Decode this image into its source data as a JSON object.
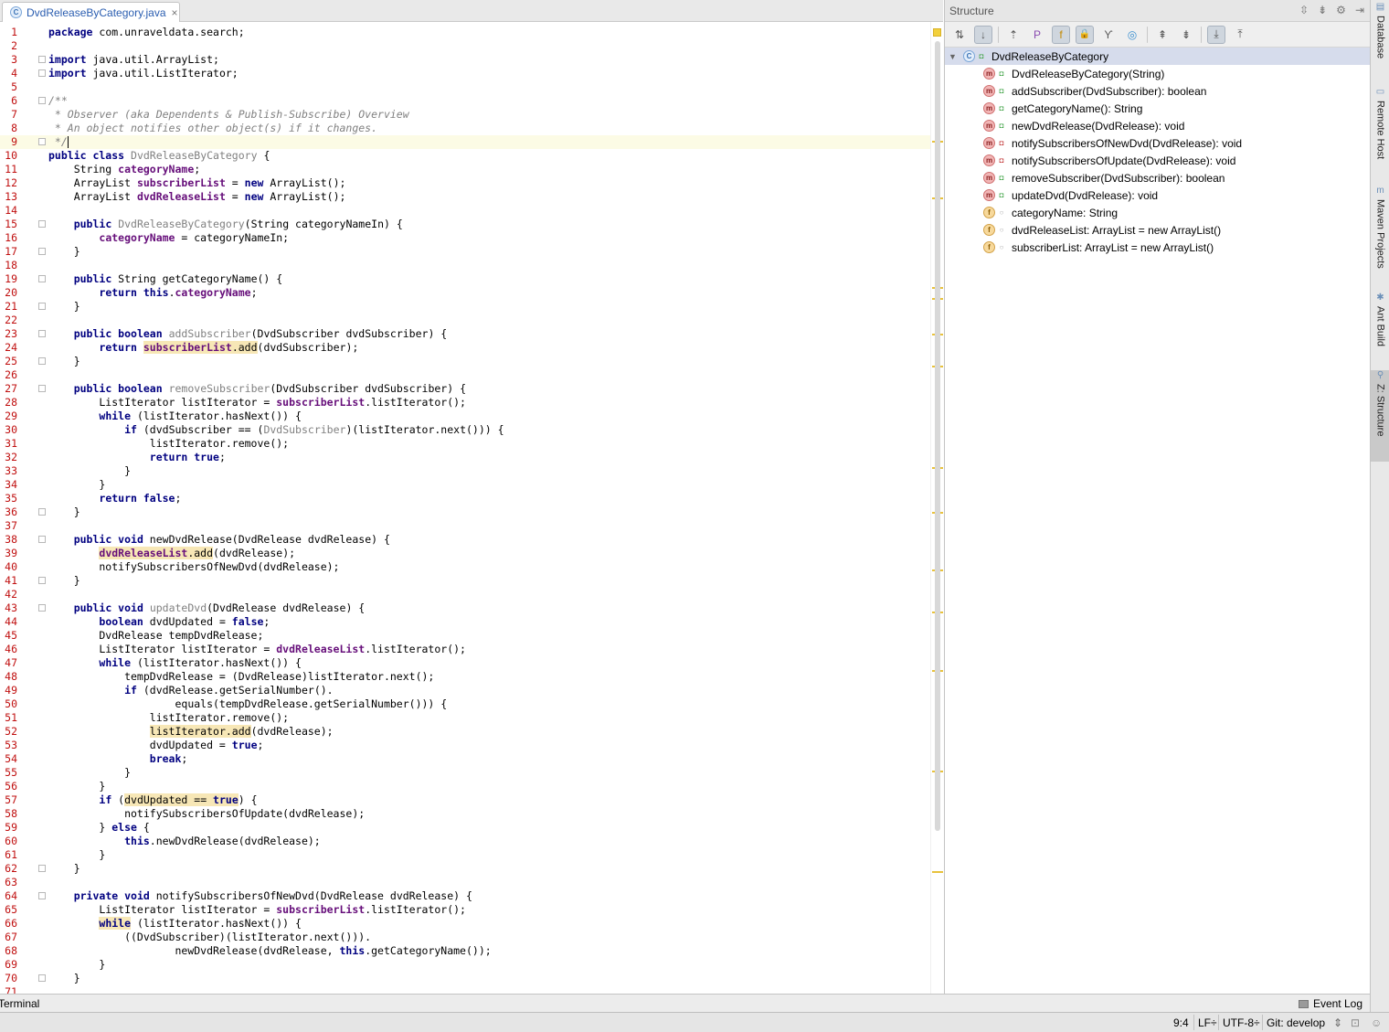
{
  "tab": {
    "icon": "C",
    "label": "DvdReleaseByCategory.java",
    "close": "×"
  },
  "editor": {
    "lines": [
      {
        "n": "1",
        "html": "<span class=\"k\">package</span> com.unraveldata.search;"
      },
      {
        "n": "2",
        "html": ""
      },
      {
        "n": "3",
        "html": "<span class=\"k\">import</span> java.util.ArrayList;"
      },
      {
        "n": "4",
        "html": "<span class=\"k\">import</span> java.util.ListIterator;"
      },
      {
        "n": "5",
        "html": ""
      },
      {
        "n": "6",
        "html": "<span class=\"c\">/**</span>"
      },
      {
        "n": "7",
        "html": "<span class=\"c\"> * Observer (aka Dependents &amp; Publish-Subscribe) Overview</span>"
      },
      {
        "n": "8",
        "html": "<span class=\"c\"> * An object notifies other object(s) if it changes.</span>"
      },
      {
        "n": "9",
        "html": "<span class=\"c\"> */</span><span class=\"caret\"></span>"
      },
      {
        "n": "10",
        "html": "<span class=\"k\">public class</span> <span class=\"u\">DvdReleaseByCategory</span> {"
      },
      {
        "n": "11",
        "html": "    String <span class=\"f\">categoryName</span>;"
      },
      {
        "n": "12",
        "html": "    ArrayList <span class=\"f\">subscriberList</span> = <span class=\"k\">new</span> ArrayList();"
      },
      {
        "n": "13",
        "html": "    ArrayList <span class=\"f\">dvdReleaseList</span> = <span class=\"k\">new</span> ArrayList();"
      },
      {
        "n": "14",
        "html": ""
      },
      {
        "n": "15",
        "html": "    <span class=\"k\">public</span> <span class=\"u\">DvdReleaseByCategory</span>(String categoryNameIn) {"
      },
      {
        "n": "16",
        "html": "        <span class=\"f\">categoryName</span> = categoryNameIn;"
      },
      {
        "n": "17",
        "html": "    }"
      },
      {
        "n": "18",
        "html": ""
      },
      {
        "n": "19",
        "html": "    <span class=\"k\">public</span> String getCategoryName() {"
      },
      {
        "n": "20",
        "html": "        <span class=\"k\">return this</span>.<span class=\"f\">categoryName</span>;"
      },
      {
        "n": "21",
        "html": "    }"
      },
      {
        "n": "22",
        "html": ""
      },
      {
        "n": "23",
        "html": "    <span class=\"k\">public boolean</span> <span class=\"u\">addSubscriber</span>(DvdSubscriber dvdSubscriber) {"
      },
      {
        "n": "24",
        "html": "        <span class=\"k\">return</span> <span class=\"hl\"><span class=\"f\">subscriberList</span>.add</span>(dvdSubscriber);"
      },
      {
        "n": "25",
        "html": "    }"
      },
      {
        "n": "26",
        "html": ""
      },
      {
        "n": "27",
        "html": "    <span class=\"k\">public boolean</span> <span class=\"u\">removeSubscriber</span>(DvdSubscriber dvdSubscriber) {"
      },
      {
        "n": "28",
        "html": "        ListIterator listIterator = <span class=\"f\">subscriberList</span>.listIterator();"
      },
      {
        "n": "29",
        "html": "        <span class=\"k\">while</span> (listIterator.hasNext()) {"
      },
      {
        "n": "30",
        "html": "            <span class=\"k\">if</span> (dvdSubscriber == (<span class=\"u\">DvdSubscriber</span>)(listIterator.next())) {"
      },
      {
        "n": "31",
        "html": "                listIterator.remove();"
      },
      {
        "n": "32",
        "html": "                <span class=\"k\">return true</span>;"
      },
      {
        "n": "33",
        "html": "            }"
      },
      {
        "n": "34",
        "html": "        }"
      },
      {
        "n": "35",
        "html": "        <span class=\"k\">return false</span>;"
      },
      {
        "n": "36",
        "html": "    }"
      },
      {
        "n": "37",
        "html": ""
      },
      {
        "n": "38",
        "html": "    <span class=\"k\">public void</span> newDvdRelease(DvdRelease dvdRelease) {"
      },
      {
        "n": "39",
        "html": "        <span class=\"hl\"><span class=\"f\">dvdReleaseList</span>.add</span>(dvdRelease);"
      },
      {
        "n": "40",
        "html": "        notifySubscribersOfNewDvd(dvdRelease);"
      },
      {
        "n": "41",
        "html": "    }"
      },
      {
        "n": "42",
        "html": ""
      },
      {
        "n": "43",
        "html": "    <span class=\"k\">public void</span> <span class=\"u\">updateDvd</span>(DvdRelease dvdRelease) {"
      },
      {
        "n": "44",
        "html": "        <span class=\"k\">boolean</span> dvdUpdated = <span class=\"k\">false</span>;"
      },
      {
        "n": "45",
        "html": "        DvdRelease tempDvdRelease;"
      },
      {
        "n": "46",
        "html": "        ListIterator listIterator = <span class=\"f\">dvdReleaseList</span>.listIterator();"
      },
      {
        "n": "47",
        "html": "        <span class=\"k\">while</span> (listIterator.hasNext()) {"
      },
      {
        "n": "48",
        "html": "            tempDvdRelease = (DvdRelease)listIterator.next();"
      },
      {
        "n": "49",
        "html": "            <span class=\"k\">if</span> (dvdRelease.getSerialNumber()."
      },
      {
        "n": "50",
        "html": "                    equals(tempDvdRelease.getSerialNumber())) {"
      },
      {
        "n": "51",
        "html": "                listIterator.remove();"
      },
      {
        "n": "52",
        "html": "                <span class=\"hl\">listIterator.add</span>(dvdRelease);"
      },
      {
        "n": "53",
        "html": "                dvdUpdated = <span class=\"k\">true</span>;"
      },
      {
        "n": "54",
        "html": "                <span class=\"k\">break</span>;"
      },
      {
        "n": "55",
        "html": "            }"
      },
      {
        "n": "56",
        "html": "        }"
      },
      {
        "n": "57",
        "html": "        <span class=\"k\">if</span> (<span class=\"hl\">dvdUpdated == <span class=\"k\">true</span></span>) {"
      },
      {
        "n": "58",
        "html": "            notifySubscribersOfUpdate(dvdRelease);"
      },
      {
        "n": "59",
        "html": "        } <span class=\"k\">else</span> {"
      },
      {
        "n": "60",
        "html": "            <span class=\"k\">this</span>.newDvdRelease(dvdRelease);"
      },
      {
        "n": "61",
        "html": "        }"
      },
      {
        "n": "62",
        "html": "    }"
      },
      {
        "n": "63",
        "html": ""
      },
      {
        "n": "64",
        "html": "    <span class=\"k\">private void</span> notifySubscribersOfNewDvd(DvdRelease dvdRelease) {"
      },
      {
        "n": "65",
        "html": "        ListIterator listIterator = <span class=\"f\">subscriberList</span>.listIterator();"
      },
      {
        "n": "66",
        "html": "        <span class=\"k hl\">while</span> (listIterator.hasNext()) {"
      },
      {
        "n": "67",
        "html": "            ((DvdSubscriber)(listIterator.next()))."
      },
      {
        "n": "68",
        "html": "                    newDvdRelease(dvdRelease, <span class=\"k\">this</span>.getCategoryName());"
      },
      {
        "n": "69",
        "html": "        }"
      },
      {
        "n": "70",
        "html": "    }"
      },
      {
        "n": "71",
        "html": ""
      }
    ],
    "fold_lines": [
      3,
      4,
      6,
      9,
      15,
      17,
      19,
      21,
      23,
      25,
      27,
      36,
      38,
      41,
      43,
      62,
      64,
      70
    ]
  },
  "stripe_marks": [
    154,
    216,
    314,
    326,
    365,
    400,
    511,
    560,
    623,
    669,
    733,
    843,
    953
  ],
  "structure": {
    "title": "Structure",
    "toolbar_icons": [
      "sort-by-type-icon",
      "sort-alpha-icon",
      "inherited-icon",
      "properties-icon",
      "fields-icon",
      "non-public-icon",
      "lambda-icon",
      "anonymous-icon",
      "expand-all-icon",
      "collapse-all-icon",
      "autoscroll-to-source-icon",
      "autoscroll-from-source-icon"
    ],
    "root": {
      "icon": "C",
      "label": "DvdReleaseByCategory"
    },
    "items": [
      {
        "kind": "m",
        "vis": "pub",
        "label": "DvdReleaseByCategory(String)"
      },
      {
        "kind": "m",
        "vis": "pub",
        "label": "addSubscriber(DvdSubscriber): boolean"
      },
      {
        "kind": "m",
        "vis": "pub",
        "label": "getCategoryName(): String"
      },
      {
        "kind": "m",
        "vis": "pub",
        "label": "newDvdRelease(DvdRelease): void"
      },
      {
        "kind": "m",
        "vis": "priv",
        "label": "notifySubscribersOfNewDvd(DvdRelease): void"
      },
      {
        "kind": "m",
        "vis": "priv",
        "label": "notifySubscribersOfUpdate(DvdRelease): void"
      },
      {
        "kind": "m",
        "vis": "pub",
        "label": "removeSubscriber(DvdSubscriber): boolean"
      },
      {
        "kind": "m",
        "vis": "pub",
        "label": "updateDvd(DvdRelease): void"
      },
      {
        "kind": "f",
        "vis": "pkg",
        "label": "categoryName: String"
      },
      {
        "kind": "f",
        "vis": "pkg",
        "label": "dvdReleaseList: ArrayList = new ArrayList()"
      },
      {
        "kind": "f",
        "vis": "pkg",
        "label": "subscriberList: ArrayList = new ArrayList()"
      }
    ]
  },
  "side_tools": [
    {
      "label": "Database",
      "icon": "▤",
      "active": false
    },
    {
      "label": "Remote Host",
      "icon": "▭",
      "active": false
    },
    {
      "label": "Maven Projects",
      "icon": "m",
      "active": false
    },
    {
      "label": "Ant Build",
      "icon": "✱",
      "active": false
    },
    {
      "label": "Z: Structure",
      "icon": "⚲",
      "active": true
    }
  ],
  "bottom": {
    "terminal": "Terminal",
    "event_log": "Event Log"
  },
  "status": {
    "position": "9:4",
    "line_sep": "LF÷",
    "encoding": "UTF-8÷",
    "vcs": "Git: develop"
  }
}
